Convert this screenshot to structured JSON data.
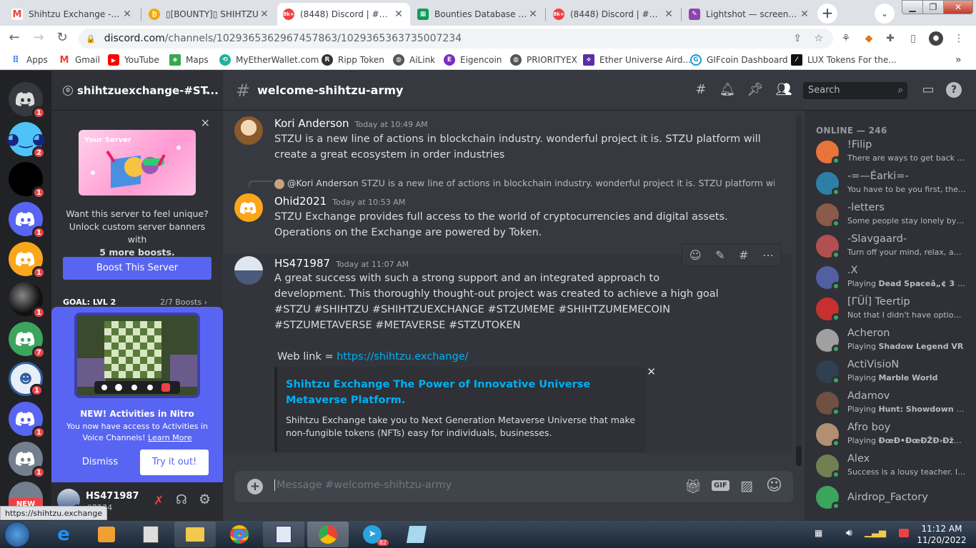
{
  "browser": {
    "tabs": [
      {
        "title": "Shihtzu Exchange - hs1",
        "icon": "gmail-icon"
      },
      {
        "title": "▯[BOUNTY]▯ SHIHTZU",
        "icon": "bitcoin-icon"
      },
      {
        "title": "(8448) Discord | #welco",
        "icon": "discord-icon",
        "badge": "8k+"
      },
      {
        "title": "Bounties Database - Go",
        "icon": "sheets-icon"
      },
      {
        "title": "(8448) Discord | #gener",
        "icon": "discord-icon",
        "badge": "8k+"
      },
      {
        "title": "Lightshot — screensho",
        "icon": "feather-icon"
      }
    ],
    "url_domain": "discord.com",
    "url_path": "/channels/1029365362967457863/1029365363735007234",
    "bookmarks": [
      "Apps",
      "Gmail",
      "YouTube",
      "Maps",
      "MyEtherWallet.com",
      "Ripp Token",
      "AiLink",
      "Eigencoin",
      "PRIORITYEX",
      "Ether Universe Aird...",
      "GIFcoin Dashboard",
      "LUX Tokens For the..."
    ],
    "bookmarks_more": "»",
    "status_url": "https://shihtzu.exchange"
  },
  "servers": {
    "badges": [
      "1",
      "2",
      "1",
      "1",
      "1",
      "1",
      "7",
      "1",
      "1",
      "1"
    ],
    "new_label": "NEW"
  },
  "sidebar": {
    "server_name": "shihtzuexchange-#ST...",
    "server_count": "0",
    "boost_img_label": "Your Server",
    "boost_line1": "Want this server to feel unique? Unlock custom server banners with",
    "boost_line2": "5 more boosts.",
    "boost_button": "Boost This Server",
    "goal_label": "GOAL: LVL 2",
    "goal_count": "2/7 Boosts"
  },
  "nitro": {
    "title": "NEW! Activities in Nitro",
    "desc": "You now have access to Activities in Voice Channels!",
    "learn_more": "Learn More",
    "dismiss": "Dismiss",
    "try": "Try it out!"
  },
  "user": {
    "name": "HS471987",
    "tag": "#2134"
  },
  "channel": {
    "name": "welcome-shihtzu-army",
    "search_placeholder": "Search"
  },
  "messages": [
    {
      "author": "Kori Anderson",
      "time": "Today at 10:49 AM",
      "text": "STZU is a new line of actions in blockchain industry. wonderful project it is. STZU platform will create a great ecosystem in order industries"
    },
    {
      "reply_author": "@Kori Anderson",
      "reply_text": "STZU is a new line of actions in blockchain industry. wonderful project it is. STZU platform will ...",
      "author": "Ohid2021",
      "time": "Today at 10:53 AM",
      "text": "STZU Exchange provides full access to the world of cryptocurrencies and digital assets. Operations on the Exchange are powered by Token."
    },
    {
      "author": "HS471987",
      "time": "Today at 11:07 AM",
      "text": "A great success with such a strong support and an integrated approach to development. This thoroughly thought-out project was created to achieve a high goal",
      "tags": "#STZU #SHIHTZU #SHIHTZUEXCHANGE #STZUMEME #SHIHTZUMEMECOIN #STZUMETAVERSE #METAVERSE #STZUTOKEN",
      "weblink_label": "Web link = ",
      "weblink": "https://shihtzu.exchange/"
    }
  ],
  "embed": {
    "title": "Shihtzu Exchange The Power of Innovative Universe Metaverse Platform.",
    "desc": "Shihtzu Exchange take you to Next Generation Metaverse Universe that make non-fungible tokens (NFTs) easy for individuals, businesses."
  },
  "composer": {
    "placeholder": "Message #welcome-shihtzu-army"
  },
  "members": {
    "header": "ONLINE — 246",
    "list": [
      {
        "name": "!Filip",
        "status": "There are ways to get back wit...",
        "status_bold": "",
        "color": "#e8743b"
      },
      {
        "name": "-=—Éarki=-",
        "status": "You have to be you first, then s...",
        "status_bold": "",
        "color": "#2e7fa8"
      },
      {
        "name": "-letters",
        "status": "Some people stay lonely by thi...",
        "status_bold": "",
        "color": "#8b5a4a"
      },
      {
        "name": "-Slavgaard-",
        "status": "Turn off your mind, relax, and ...",
        "status_bold": "",
        "color": "#b05050"
      },
      {
        "name": ".X",
        "status": "Playing ",
        "status_bold": "Dead Spaceâ„¢ 3 First ...",
        "color": "#5060a0"
      },
      {
        "name": "[ΓÜĺ] Teertip",
        "status": "Not that I didn't have options, ...",
        "status_bold": "",
        "color": "#c83030"
      },
      {
        "name": "Acheron",
        "status": "Playing ",
        "status_bold": "Shadow Legend VR",
        "color": "#a0a0a0"
      },
      {
        "name": "ActiVisioN",
        "status": "Playing ",
        "status_bold": "Marble World",
        "color": "#304050"
      },
      {
        "name": "Adamov",
        "status": "Playing ",
        "status_bold": "Hunt: Showdown - Ronin",
        "color": "#705040"
      },
      {
        "name": "Afro boy",
        "status": "Playing ",
        "status_bold": "ÐœÐ•ÐœÐŽÐ›ÐžÐ“Ð...",
        "color": "#b09070"
      },
      {
        "name": "Alex",
        "status": "Success is a lousy teacher. It se...",
        "status_bold": "",
        "color": "#708050"
      },
      {
        "name": "Airdrop_Factory",
        "status": "",
        "status_bold": "",
        "color": "#3ba55d"
      }
    ]
  },
  "taskbar": {
    "time": "11:12 AM",
    "date": "11/20/2022",
    "telegram_badge": "82"
  }
}
